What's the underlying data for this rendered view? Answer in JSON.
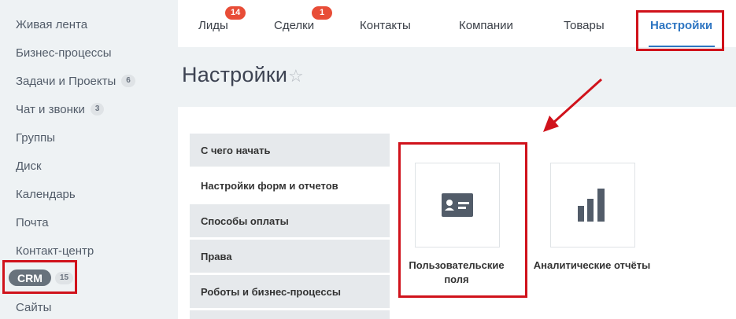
{
  "sidebar": {
    "items": [
      {
        "label": "Живая лента"
      },
      {
        "label": "Бизнес-процессы"
      },
      {
        "label": "Задачи и Проекты",
        "badge": "6"
      },
      {
        "label": "Чат и звонки",
        "badge": "3"
      },
      {
        "label": "Группы"
      },
      {
        "label": "Диск"
      },
      {
        "label": "Календарь"
      },
      {
        "label": "Почта"
      },
      {
        "label": "Контакт-центр"
      },
      {
        "label": "Сайты"
      }
    ],
    "crm": {
      "label": "CRM",
      "badge": "15"
    }
  },
  "topnav": {
    "tabs": [
      {
        "label": "Лиды",
        "badge": "14"
      },
      {
        "label": "Сделки",
        "badge": "1"
      },
      {
        "label": "Контакты"
      },
      {
        "label": "Компании"
      },
      {
        "label": "Товары"
      },
      {
        "label": "Настройки"
      }
    ]
  },
  "page": {
    "title": "Настройки",
    "star_icon": "star-icon"
  },
  "settings_menu": [
    {
      "label": "С чего начать"
    },
    {
      "label": "Настройки форм и отчетов"
    },
    {
      "label": "Способы оплаты"
    },
    {
      "label": "Права"
    },
    {
      "label": "Роботы и бизнес-процессы"
    }
  ],
  "tiles": [
    {
      "label": "Пользовательские поля",
      "icon": "id-card-icon"
    },
    {
      "label": "Аналитические отчёты",
      "icon": "bar-chart-icon"
    }
  ],
  "colors": {
    "highlight": "#d0121b",
    "badge_red": "#e84d37",
    "active_tab": "#2d75c2",
    "icon_gray": "#525c69"
  }
}
